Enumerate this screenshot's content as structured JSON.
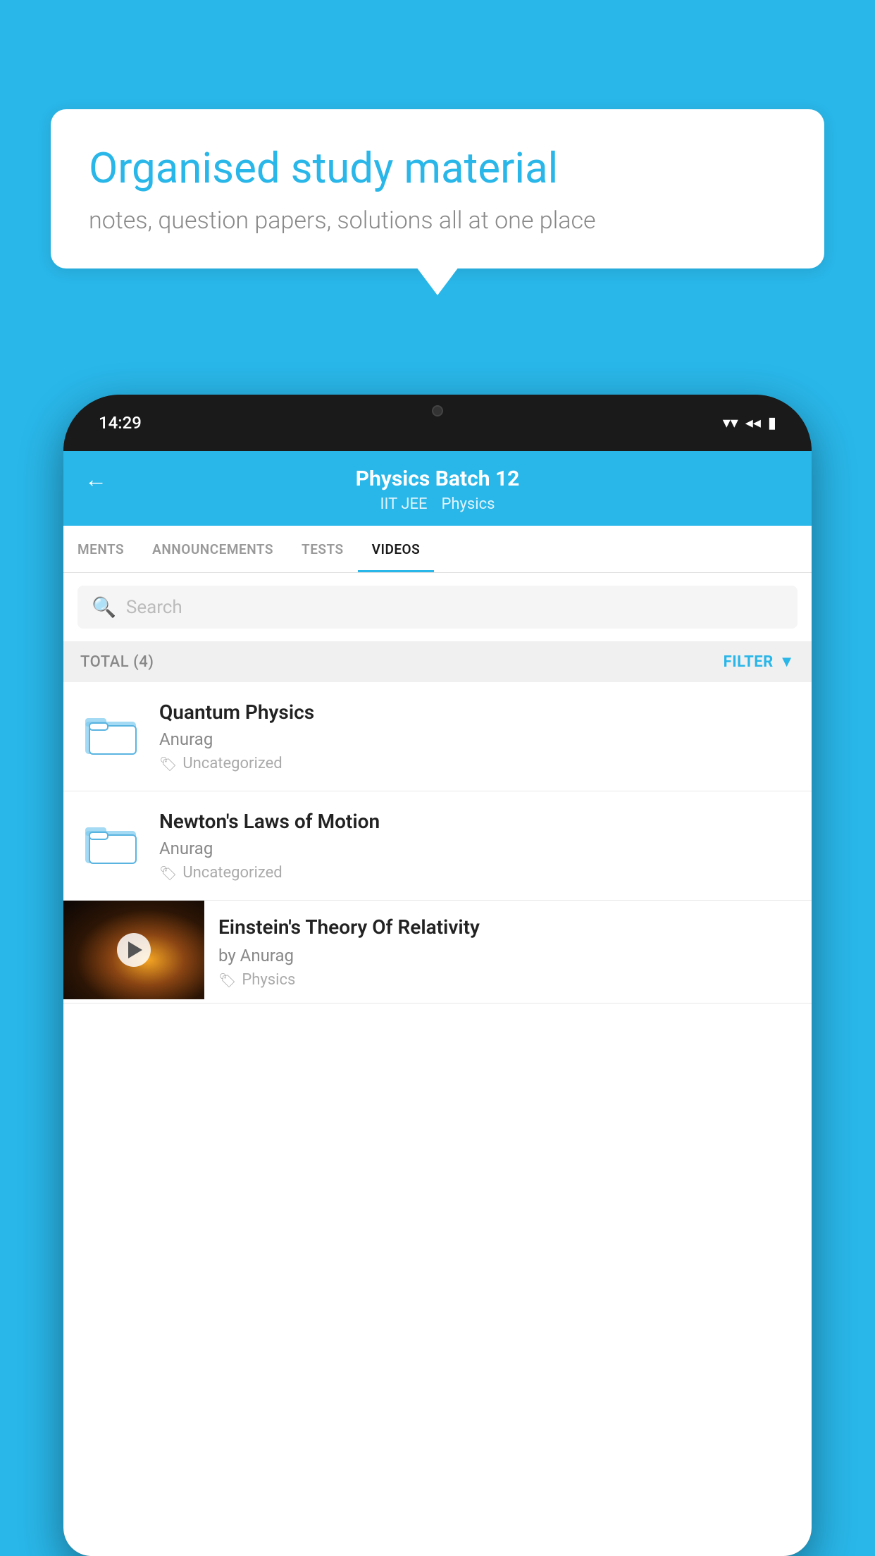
{
  "background_color": "#29b6e8",
  "speech_bubble": {
    "title": "Organised study material",
    "subtitle": "notes, question papers, solutions all at one place"
  },
  "status_bar": {
    "time": "14:29",
    "wifi": "▼",
    "signal": "▲",
    "battery": "▮"
  },
  "header": {
    "back_label": "←",
    "title": "Physics Batch 12",
    "subtitle1": "IIT JEE",
    "subtitle2": "Physics"
  },
  "tabs": [
    {
      "label": "MENTS",
      "active": false
    },
    {
      "label": "ANNOUNCEMENTS",
      "active": false
    },
    {
      "label": "TESTS",
      "active": false
    },
    {
      "label": "VIDEOS",
      "active": true
    }
  ],
  "search": {
    "placeholder": "Search"
  },
  "filter_bar": {
    "total_label": "TOTAL (4)",
    "filter_label": "FILTER"
  },
  "videos": [
    {
      "title": "Quantum Physics",
      "author": "Anurag",
      "tag": "Uncategorized",
      "has_thumbnail": false
    },
    {
      "title": "Newton's Laws of Motion",
      "author": "Anurag",
      "tag": "Uncategorized",
      "has_thumbnail": false
    },
    {
      "title": "Einstein's Theory Of Relativity",
      "author": "by Anurag",
      "tag": "Physics",
      "has_thumbnail": true
    }
  ]
}
